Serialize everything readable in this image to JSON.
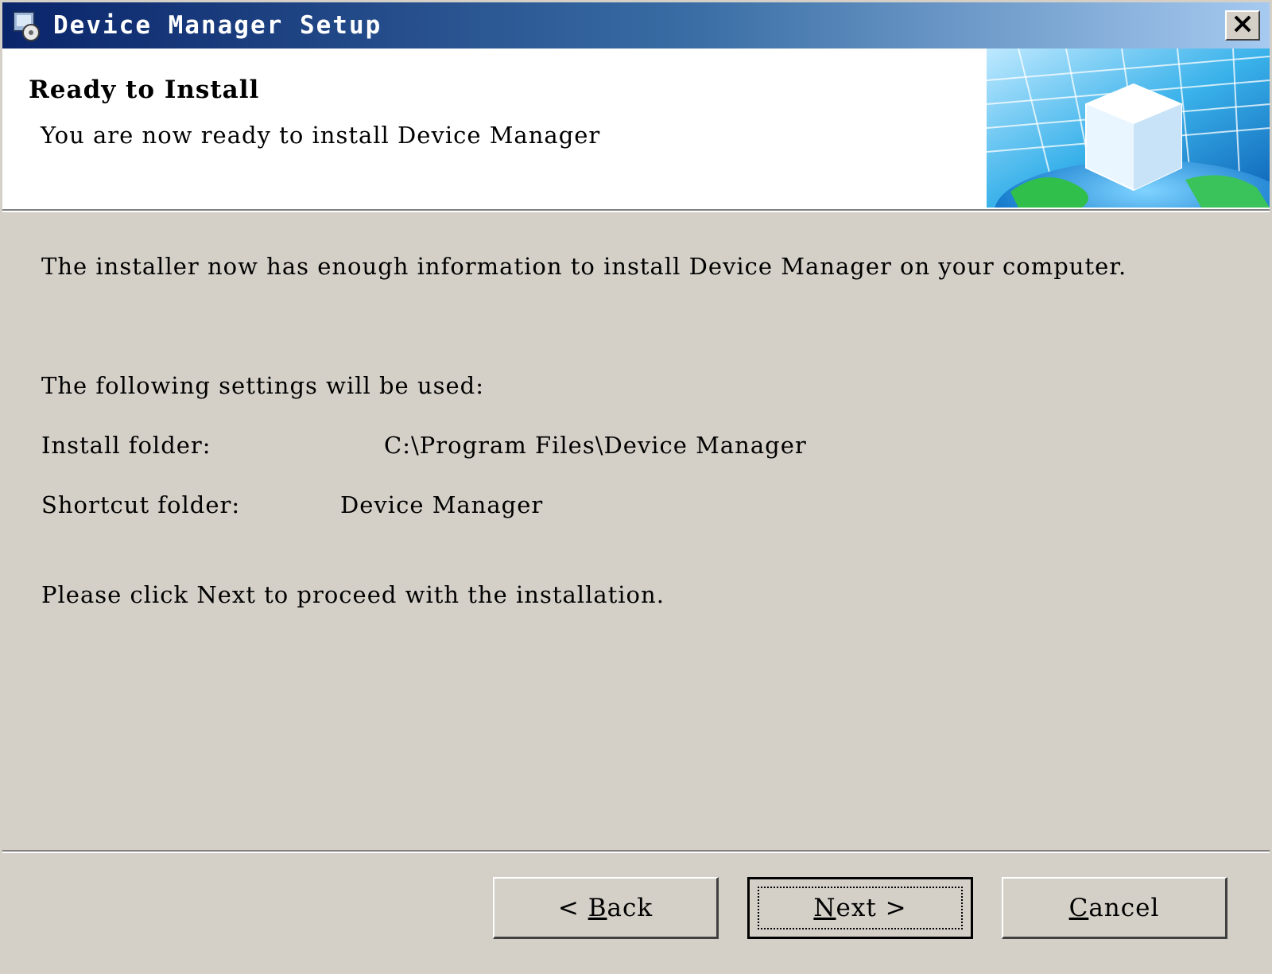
{
  "window": {
    "title": "Device Manager Setup"
  },
  "header": {
    "title": "Ready to Install",
    "subtitle": "You are now ready to install Device Manager"
  },
  "content": {
    "intro": "The installer now has enough information to install Device Manager on your computer.",
    "settings_heading": "The following settings will be used:",
    "install_folder_label": "Install folder:",
    "install_folder_value": "C:\\Program Files\\Device Manager",
    "shortcut_folder_label": "Shortcut folder:",
    "shortcut_folder_value": "Device Manager",
    "proceed_text": "Please click Next to proceed with the installation."
  },
  "buttons": {
    "back": {
      "prefix": "< ",
      "mnemonic": "B",
      "rest": "ack"
    },
    "next": {
      "mnemonic": "N",
      "rest": "ext",
      "suffix": " >"
    },
    "cancel": {
      "mnemonic": "C",
      "rest": "ancel"
    }
  },
  "icons": {
    "app": "setup-disk-icon",
    "close": "close-icon"
  },
  "colors": {
    "titlebar_start": "#0a246a",
    "titlebar_end": "#a6caf0",
    "dialog_bg": "#d4d0c8"
  }
}
